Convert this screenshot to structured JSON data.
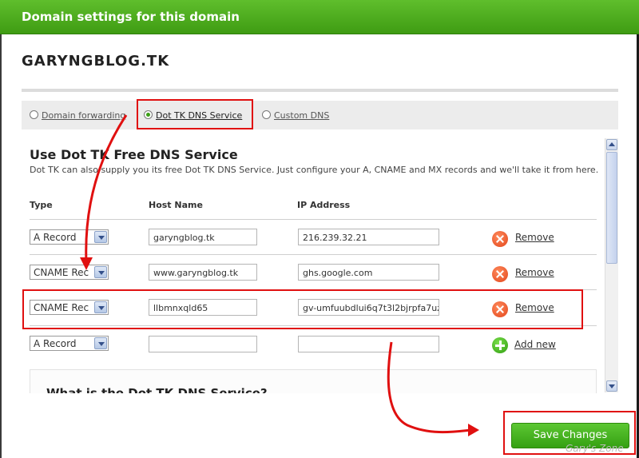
{
  "dialog": {
    "title": "Domain settings for this domain"
  },
  "domain": "GARYNGBLOG.TK",
  "options": [
    {
      "label": "Domain forwarding",
      "selected": false
    },
    {
      "label": "Dot TK DNS Service",
      "selected": true
    },
    {
      "label": "Custom DNS",
      "selected": false
    }
  ],
  "section": {
    "title": "Use Dot TK Free DNS Service",
    "description": "Dot TK can also supply you its free Dot TK DNS Service. Just configure your A, CNAME and MX records and we'll take it from here."
  },
  "table": {
    "headers": {
      "type": "Type",
      "host": "Host Name",
      "ip": "IP Address"
    },
    "rows": [
      {
        "type": "A Record",
        "host": "garyngblog.tk",
        "ip": "216.239.32.21",
        "action": "Remove"
      },
      {
        "type": "CNAME Rec",
        "host": "www.garyngblog.tk",
        "ip": "ghs.google.com",
        "action": "Remove"
      },
      {
        "type": "CNAME Rec",
        "host": "llbmnxqld65",
        "ip": "gv-umfuubdlui6q7t3l2bjrpfa7uz",
        "action": "Remove"
      },
      {
        "type": "A Record",
        "host": "",
        "ip": "",
        "action": "Add new"
      }
    ]
  },
  "info": {
    "heading": "What is the Dot TK DNS Service?"
  },
  "buttons": {
    "save": "Save Changes"
  },
  "watermark": "Gary's Zone",
  "colors": {
    "titlebar": "#4caf20",
    "annotation": "#e01010",
    "save": "#3fa818"
  },
  "icons": {
    "remove": "remove-x-icon",
    "add": "add-plus-icon"
  }
}
